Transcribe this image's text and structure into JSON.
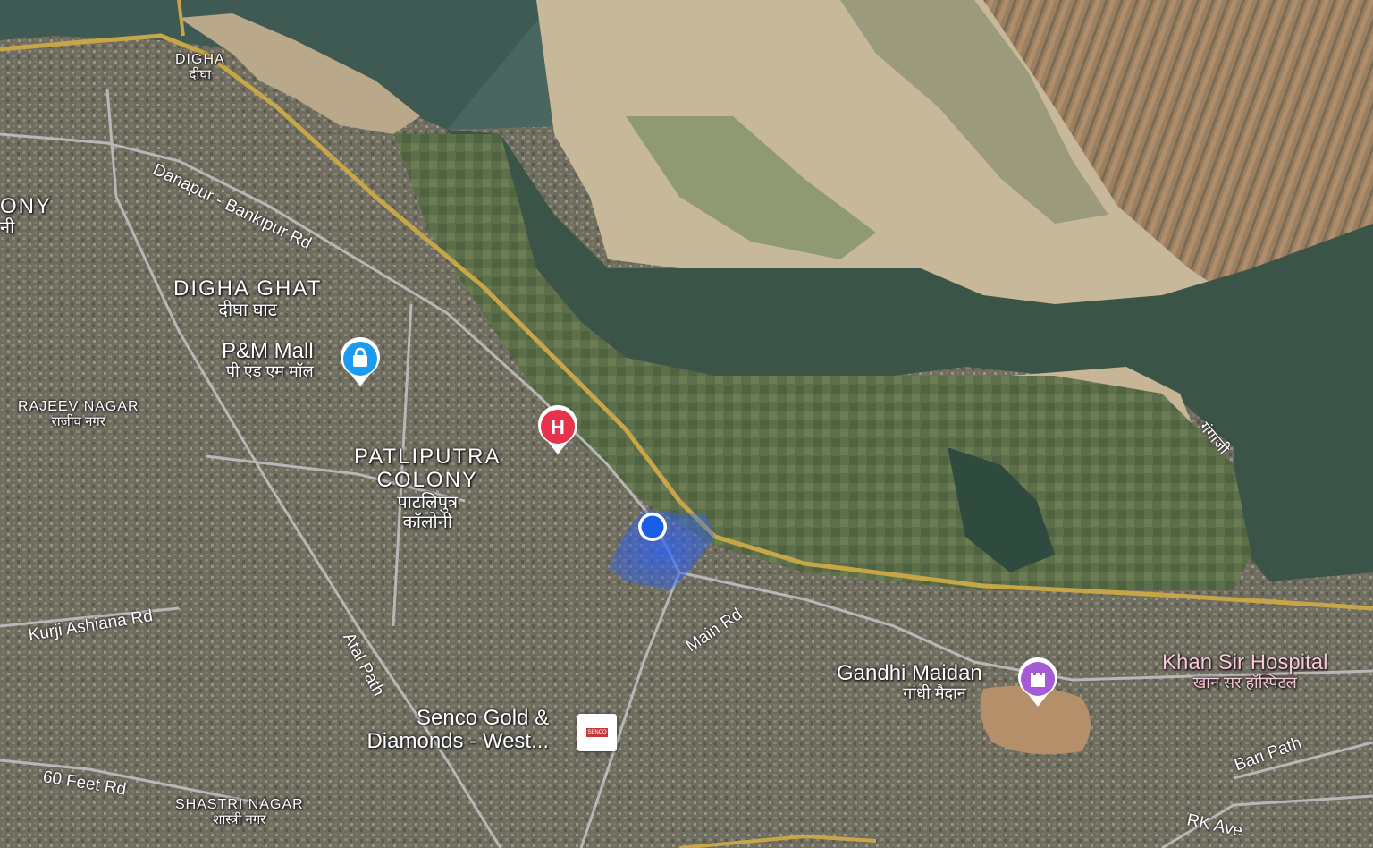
{
  "map": {
    "areas": {
      "digha": {
        "en": "DIGHA",
        "hi": "दीघा"
      },
      "colony_left": {
        "en": "ONY",
        "hi": "नी"
      },
      "digha_ghat": {
        "en": "DIGHA GHAT",
        "hi": "दीघा घाट"
      },
      "rajeev_nagar": {
        "en": "RAJEEV NAGAR",
        "hi": "राजीव नगर"
      },
      "patliputra": {
        "en1": "PATLIPUTRA",
        "en2": "COLONY",
        "hi1": "पाटलिपुत्र",
        "hi2": "कॉलोनी"
      },
      "shastri_nagar": {
        "en": "SHASTRI NAGAR",
        "hi": "शास्त्री नगर"
      }
    },
    "pois": {
      "pm_mall": {
        "en": "P&M Mall",
        "hi": "पी एंड एम मॉल",
        "icon": "shopping-bag-icon",
        "color": "#1a9bf0"
      },
      "gandhi_maidan": {
        "en": "Gandhi Maidan",
        "hi": "गांधी मैदान",
        "icon": "castle-icon",
        "color": "#a65bd6"
      },
      "khan_sir": {
        "en": "Khan Sir Hospital",
        "hi": "खान सर हॉस्पिटल",
        "color": "#f2a0c0"
      },
      "senco": {
        "line1": "Senco Gold &",
        "line2": "Diamonds - West...",
        "badge": "SENCO"
      },
      "hospital": {
        "icon": "hospital-icon",
        "letter": "H",
        "color": "#e8314a"
      }
    },
    "roads": {
      "danapur": "Danapur - Bankipur Rd",
      "kurji": "Kurji Ashiana Rd",
      "atal": "Atal Path",
      "main": "Main Rd",
      "sixty_feet": "60 Feet Rd",
      "bari": "Bari Path",
      "rk": "RK Ave"
    },
    "river": "गंगाजी",
    "location_marker": {
      "icon": "current-location-icon",
      "color": "#1a5ee8"
    }
  }
}
